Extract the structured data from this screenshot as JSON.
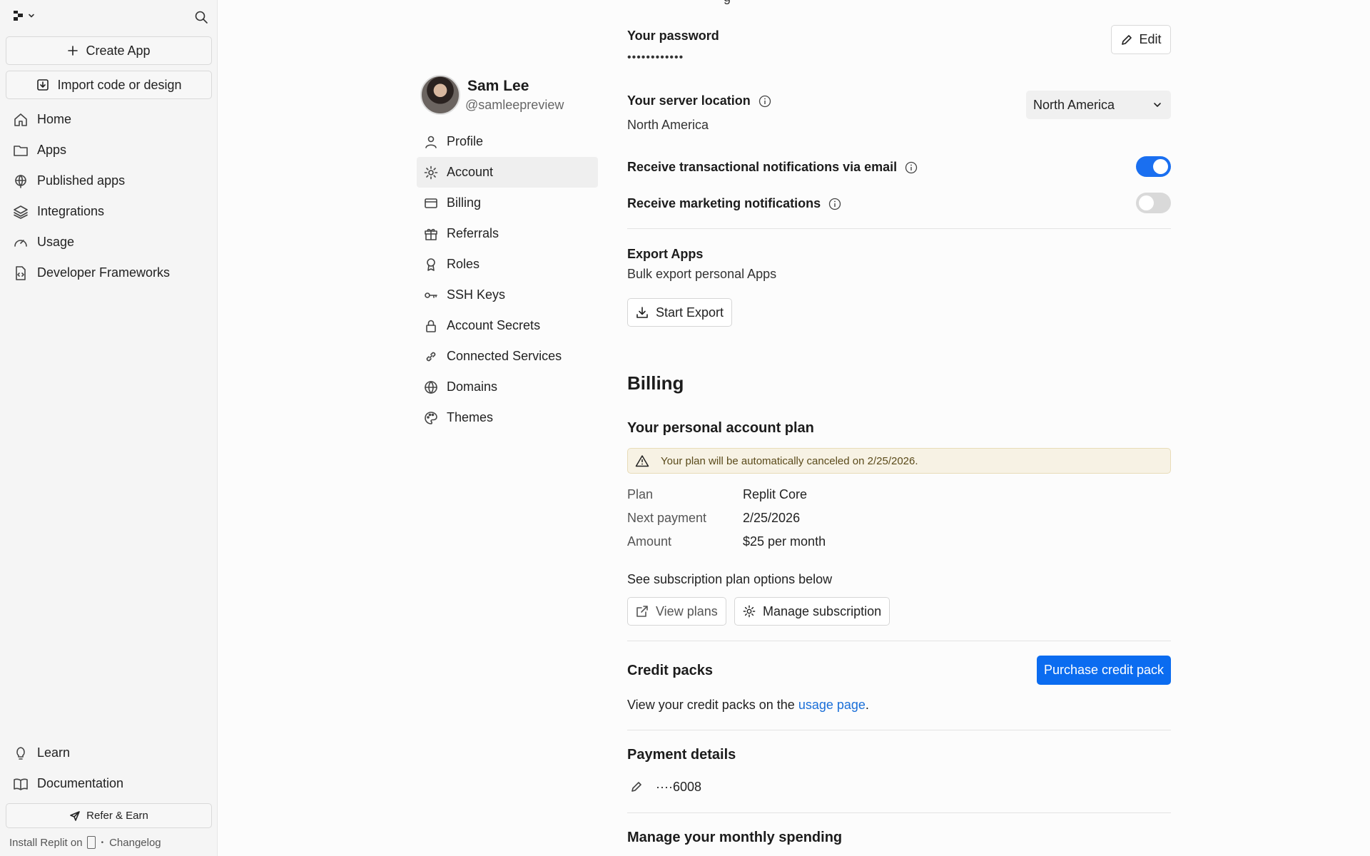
{
  "sidebar": {
    "create_app": "Create App",
    "import_label": "Import code or design",
    "items": [
      {
        "label": "Home",
        "icon": "home-icon"
      },
      {
        "label": "Apps",
        "icon": "folder-icon"
      },
      {
        "label": "Published apps",
        "icon": "globe-icon"
      },
      {
        "label": "Integrations",
        "icon": "layers-icon"
      },
      {
        "label": "Usage",
        "icon": "gauge-icon"
      },
      {
        "label": "Developer Frameworks",
        "icon": "file-code-icon"
      }
    ],
    "bottom_items": [
      {
        "label": "Learn",
        "icon": "lightbulb-icon"
      },
      {
        "label": "Documentation",
        "icon": "book-icon"
      }
    ],
    "refer_label": "Refer & Earn",
    "install_label": "Install Replit on",
    "bullet": "•",
    "changelog_label": "Changelog"
  },
  "profile": {
    "name": "Sam Lee",
    "handle": "@samleepreview"
  },
  "settings_nav": {
    "items": [
      {
        "label": "Profile",
        "icon": "user-icon"
      },
      {
        "label": "Account",
        "icon": "gear-icon",
        "active": true
      },
      {
        "label": "Billing",
        "icon": "credit-card-icon"
      },
      {
        "label": "Referrals",
        "icon": "gift-icon"
      },
      {
        "label": "Roles",
        "icon": "award-icon"
      },
      {
        "label": "SSH Keys",
        "icon": "key-icon"
      },
      {
        "label": "Account Secrets",
        "icon": "lock-icon"
      },
      {
        "label": "Connected Services",
        "icon": "link-icon"
      },
      {
        "label": "Domains",
        "icon": "globe-icon"
      },
      {
        "label": "Themes",
        "icon": "palette-icon"
      }
    ]
  },
  "account": {
    "top_clip": "g",
    "password_label": "Your password",
    "password_value": "••••••••••••",
    "edit_label": "Edit",
    "server_label": "Your server location",
    "server_value": "North America",
    "server_select": "North America",
    "transactional_label": "Receive transactional notifications via email",
    "transactional_on": true,
    "marketing_label": "Receive marketing notifications",
    "marketing_on": false,
    "export_title": "Export Apps",
    "export_desc": "Bulk export personal Apps",
    "export_button": "Start Export"
  },
  "billing": {
    "heading": "Billing",
    "plan_heading": "Your personal account plan",
    "warning": "Your plan will be automatically canceled on 2/25/2026.",
    "plan_label": "Plan",
    "plan_value": "Replit Core",
    "next_label": "Next payment",
    "next_value": "2/25/2026",
    "amount_label": "Amount",
    "amount_value": "$25 per month",
    "options_text": "See subscription plan options below",
    "view_plans": "View plans",
    "manage_subscription": "Manage subscription",
    "credit_heading": "Credit packs",
    "purchase_button": "Purchase credit pack",
    "credit_text_pre": "View your credit packs on the",
    "credit_link": "usage page",
    "credit_text_post": ".",
    "payment_heading": "Payment details",
    "card_value": "····6008",
    "spending_heading": "Manage your monthly spending"
  },
  "colors": {
    "accent": "#0b6cf0",
    "toggle_on": "#1a6ff0",
    "link": "#1a6fd8",
    "warning_bg": "#f7f2e4"
  }
}
